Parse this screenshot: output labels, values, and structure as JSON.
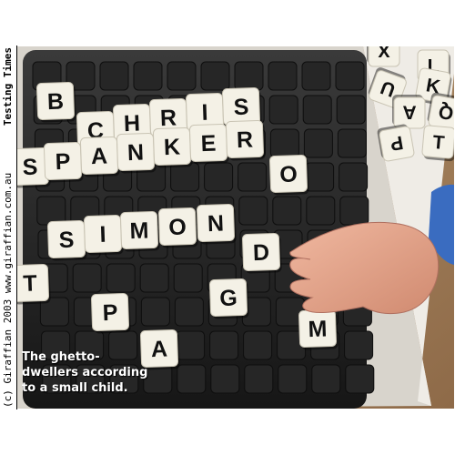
{
  "sidebar": {
    "credit": "(c) Giraffian 2003 www.giraffian.com.au",
    "title": "Testing Times"
  },
  "caption": {
    "line1": "The ghetto-",
    "line2": "dwellers according",
    "line3": "to a small child."
  },
  "photo": {
    "board_tiles": [
      {
        "letter": "B"
      },
      {
        "letter": "C"
      },
      {
        "letter": "H"
      },
      {
        "letter": "R"
      },
      {
        "letter": "I"
      },
      {
        "letter": "S"
      },
      {
        "letter": "S"
      },
      {
        "letter": "P"
      },
      {
        "letter": "A"
      },
      {
        "letter": "N"
      },
      {
        "letter": "K"
      },
      {
        "letter": "E"
      },
      {
        "letter": "R"
      },
      {
        "letter": "O"
      },
      {
        "letter": "S"
      },
      {
        "letter": "I"
      },
      {
        "letter": "M"
      },
      {
        "letter": "O"
      },
      {
        "letter": "N"
      },
      {
        "letter": "D"
      },
      {
        "letter": "T"
      },
      {
        "letter": "G"
      },
      {
        "letter": "P"
      },
      {
        "letter": "M"
      },
      {
        "letter": "A"
      }
    ],
    "loose_tiles": [
      {
        "letter": "X"
      },
      {
        "letter": "L"
      },
      {
        "letter": "U"
      },
      {
        "letter": "K"
      },
      {
        "letter": "A"
      },
      {
        "letter": "Q"
      },
      {
        "letter": "P"
      },
      {
        "letter": "T"
      }
    ]
  }
}
